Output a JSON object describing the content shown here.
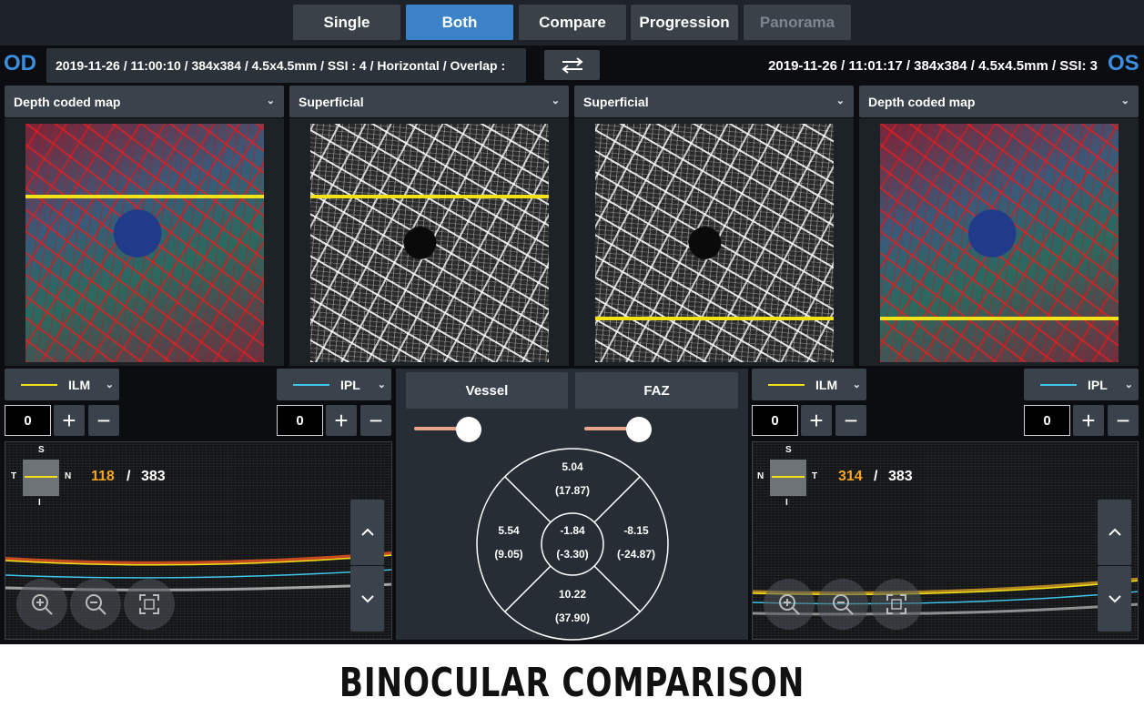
{
  "tabs": [
    {
      "label": "Single",
      "state": "normal"
    },
    {
      "label": "Both",
      "state": "active"
    },
    {
      "label": "Compare",
      "state": "normal"
    },
    {
      "label": "Progression",
      "state": "normal"
    },
    {
      "label": "Panorama",
      "state": "disabled"
    }
  ],
  "left_eye": {
    "label": "OD",
    "scan_info": "2019-11-26 / 11:00:10 / 384x384 / 4.5x4.5mm / SSI : 4 / Horizontal / Overlap :",
    "panels": [
      {
        "title": "Depth coded map"
      },
      {
        "title": "Superficial"
      }
    ],
    "layers": {
      "top": {
        "label": "ILM",
        "color": "#f2e318",
        "offset": "0"
      },
      "bottom": {
        "label": "IPL",
        "color": "#3ec7e8",
        "offset": "0"
      }
    },
    "bscan": {
      "nav": {
        "top": "S",
        "bottom": "I",
        "left": "T",
        "right": "N"
      },
      "current": "118",
      "separator": "/",
      "total": "383"
    }
  },
  "right_eye": {
    "label": "OS",
    "scan_info": "2019-11-26 / 11:01:17 / 384x384 / 4.5x4.5mm / SSI: 3",
    "panels": [
      {
        "title": "Superficial"
      },
      {
        "title": "Depth coded map"
      }
    ],
    "layers": {
      "top": {
        "label": "ILM",
        "color": "#f2e318",
        "offset": "0"
      },
      "bottom": {
        "label": "IPL",
        "color": "#3ec7e8",
        "offset": "0"
      }
    },
    "bscan": {
      "nav": {
        "top": "S",
        "bottom": "I",
        "left": "N",
        "right": "T"
      },
      "current": "314",
      "separator": "/",
      "total": "383"
    }
  },
  "controls": {
    "plus": "+",
    "minus": "−",
    "up": "^",
    "down": "v"
  },
  "center": {
    "vessel_label": "Vessel",
    "faz_label": "FAZ",
    "vessel_slider": 0.85,
    "faz_slider": 0.85,
    "sectors": {
      "superior": {
        "value": "5.04",
        "sub": "(17.87)"
      },
      "nasal_left": {
        "value": "5.54",
        "sub": "(9.05)"
      },
      "center": {
        "value": "-1.84",
        "sub": "(-3.30)"
      },
      "temporal_right": {
        "value": "-8.15",
        "sub": "(-24.87)"
      },
      "inferior": {
        "value": "10.22",
        "sub": "(37.90)"
      }
    }
  },
  "accent_colors": {
    "active_tab": "#3b82c8",
    "eye_label": "#3b8fe0",
    "slice_index": "#f5a623",
    "slider_track": "#e8a489"
  },
  "caption": "BINOCULAR COMPARISON"
}
